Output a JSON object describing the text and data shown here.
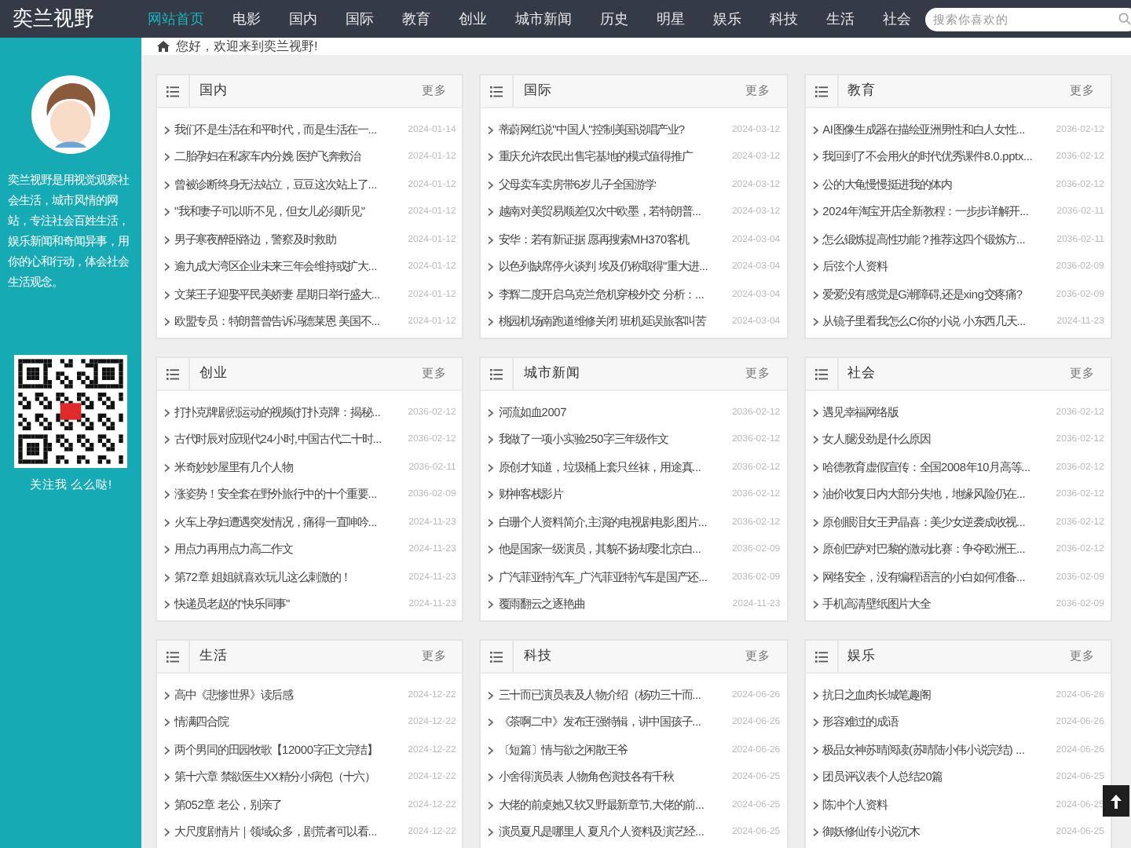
{
  "header": {
    "logo": "奕兰视野",
    "nav": [
      {
        "label": "网站首页",
        "selected": true
      },
      {
        "label": "电影",
        "selected": false
      },
      {
        "label": "国内",
        "selected": false
      },
      {
        "label": "国际",
        "selected": false
      },
      {
        "label": "教育",
        "selected": false
      },
      {
        "label": "创业",
        "selected": false
      },
      {
        "label": "城市新闻",
        "selected": false
      },
      {
        "label": "历史",
        "selected": false
      },
      {
        "label": "明星",
        "selected": false
      },
      {
        "label": "娱乐",
        "selected": false
      },
      {
        "label": "科技",
        "selected": false
      },
      {
        "label": "生活",
        "selected": false
      },
      {
        "label": "社会",
        "selected": false
      }
    ],
    "search": {
      "placeholder": "搜索你喜欢的"
    }
  },
  "breadcrumb": {
    "text": "您好，欢迎来到奕兰视野!"
  },
  "sidebar": {
    "intro": "奕兰视野是用视觉观察社会生活，城市风情的网站，专注社会百姓生活，娱乐新闻和奇闻异事，用你的心和行动，体会社会生活观念。",
    "follow": "关注我 么么哒!"
  },
  "panels": [
    {
      "title": "国内",
      "more": "更多",
      "items": [
        {
          "title": "我们不是生活在和平时代，而是生活在一...",
          "date": "2024-01-14"
        },
        {
          "title": "二胎孕妇在私家车内分娩 医护飞奔救治",
          "date": "2024-01-12"
        },
        {
          "title": "曾被诊断终身无法站立，豆豆这次站上了...",
          "date": "2024-01-12"
        },
        {
          "title": "\"我和妻子可以听不见，但女儿必须听见\"",
          "date": "2024-01-12"
        },
        {
          "title": "男子寒夜醉卧路边，警察及时救助",
          "date": "2024-01-12"
        },
        {
          "title": "逾九成大湾区企业未来三年会维持或扩大...",
          "date": "2024-01-12"
        },
        {
          "title": "文莱王子迎娶平民美娇妻 星期日举行盛大...",
          "date": "2024-01-12"
        },
        {
          "title": "欧盟专员：特朗普曾告诉冯德莱恩 美国不...",
          "date": "2024-01-12"
        }
      ]
    },
    {
      "title": "国际",
      "more": "更多",
      "items": [
        {
          "title": "蒂蔚网红说\"中国人\"控制美国说唱产业?",
          "date": "2024-03-12"
        },
        {
          "title": "重庆允许农民出售宅基地的模式值得推广",
          "date": "2024-03-12"
        },
        {
          "title": "父母卖车卖房带6岁儿子全国游学",
          "date": "2024-03-12"
        },
        {
          "title": "越南对美贸易顺差仅次中欧墨，若特朗普...",
          "date": "2024-03-12"
        },
        {
          "title": "安华：若有新证据 愿再搜索MH370客机",
          "date": "2024-03-04"
        },
        {
          "title": "以色列缺席停火谈判 埃及仍称取得\"重大进...",
          "date": "2024-03-04"
        },
        {
          "title": "李辉二度开启乌克兰危机穿梭外交 分析：...",
          "date": "2024-03-04"
        },
        {
          "title": "桃园机场南跑道维修关闭 班机延误旅客叫苦",
          "date": "2024-03-04"
        }
      ]
    },
    {
      "title": "教育",
      "more": "更多",
      "items": [
        {
          "title": "AI图像生成器在描绘亚洲男性和白人女性...",
          "date": "2036-02-12"
        },
        {
          "title": "我回到了不会用火的时代优秀课件8.0.pptx...",
          "date": "2036-02-12"
        },
        {
          "title": "公的大龟慢慢挺进我的体内",
          "date": "2036-02-12"
        },
        {
          "title": "2024年淘宝开店全新教程：一步步详解开...",
          "date": "2036-02-11"
        },
        {
          "title": "怎么锻炼提高性功能？推荐这四个锻炼方...",
          "date": "2036-02-11"
        },
        {
          "title": "后弦个人资料",
          "date": "2036-02-09"
        },
        {
          "title": "爱爱没有感觉是G潮障碍,还是xing交疼痛?",
          "date": "2036-02-09"
        },
        {
          "title": "从镜子里看我怎么C你的小说 小东西几天...",
          "date": "2024-11-23"
        }
      ]
    },
    {
      "title": "创业",
      "more": "更多",
      "items": [
        {
          "title": "打扑克牌剧烈运动的视频(打扑克牌：揭秘...",
          "date": "2036-02-12"
        },
        {
          "title": "古代时辰对应现代24小时,中国古代二十时...",
          "date": "2036-02-12"
        },
        {
          "title": "米奇妙妙屋里有几个人物",
          "date": "2036-02-11"
        },
        {
          "title": "涨姿势！安全套在野外旅行中的十个重要...",
          "date": "2036-02-09"
        },
        {
          "title": "火车上孕妇遭遇突发情况，痛得一直呻吟...",
          "date": "2024-11-23"
        },
        {
          "title": "用点力再用点力高二作文",
          "date": "2024-11-23"
        },
        {
          "title": "第72章 姐姐就喜欢玩儿这么刺激的！",
          "date": "2024-11-23"
        },
        {
          "title": "快递员老赵的\"快乐同事\"",
          "date": "2024-11-23"
        }
      ]
    },
    {
      "title": "城市新闻",
      "more": "更多",
      "items": [
        {
          "title": "河流如血2007",
          "date": "2036-02-12"
        },
        {
          "title": "我做了一项小实验250字三年级作文",
          "date": "2036-02-12"
        },
        {
          "title": "原创才知道，垃圾桶上套只丝袜，用途真...",
          "date": "2036-02-12"
        },
        {
          "title": "财神客栈影片",
          "date": "2036-02-12"
        },
        {
          "title": "白珊个人资料简介,主演的电视剧电影,图片...",
          "date": "2036-02-12"
        },
        {
          "title": "他是国家一级演员，其貌不扬却娶北京白...",
          "date": "2036-02-09"
        },
        {
          "title": "广汽菲亚特汽车_广汽菲亚特汽车是国产还...",
          "date": "2036-02-09"
        },
        {
          "title": "覆雨翻云之逐艳曲",
          "date": "2024-11-23"
        }
      ]
    },
    {
      "title": "社会",
      "more": "更多",
      "items": [
        {
          "title": "遇见幸福网络版",
          "date": "2036-02-12"
        },
        {
          "title": "女人腿没劲是什么原因",
          "date": "2036-02-12"
        },
        {
          "title": "哈德教育虚假宣传：全国2008年10月高等...",
          "date": "2036-02-12"
        },
        {
          "title": "油价收复日内大部分失地，地缘风险仍在...",
          "date": "2036-02-12"
        },
        {
          "title": "原创眼泪女王尹晶喜：美少女逆袭成收视...",
          "date": "2036-02-12"
        },
        {
          "title": "原创巴萨对巴黎的激动比赛：争夺欧洲王...",
          "date": "2036-02-12"
        },
        {
          "title": "网络安全，没有编程语言的小白如何准备...",
          "date": "2036-02-09"
        },
        {
          "title": "手机高清壁纸图片大全",
          "date": "2036-02-09"
        }
      ]
    },
    {
      "title": "生活",
      "more": "更多",
      "items": [
        {
          "title": "高中《悲惨世界》读后感",
          "date": "2024-12-22"
        },
        {
          "title": "情满四合院",
          "date": "2024-12-22"
        },
        {
          "title": "两个男同的田园牧歌【12000字正文完结】",
          "date": "2024-12-22"
        },
        {
          "title": "第十六章 禁欲医生XX精分小病包（十六）",
          "date": "2024-12-22"
        },
        {
          "title": "第052章 老公，别亲了",
          "date": "2024-12-22"
        },
        {
          "title": "大尺度剧情片｜领域众多，剧荒者可以看...",
          "date": "2024-12-22"
        }
      ]
    },
    {
      "title": "科技",
      "more": "更多",
      "items": [
        {
          "title": "三十而已演员表及人物介绍（杨功三十而...",
          "date": "2024-06-26"
        },
        {
          "title": "《茶啊二中》发布王强特辑，讲中国孩子...",
          "date": "2024-06-26"
        },
        {
          "title": "〔短篇〕情与欲之闲散王爷",
          "date": "2024-06-26"
        },
        {
          "title": "小舍得演员表 人物角色演技各有千秋",
          "date": "2024-06-25"
        },
        {
          "title": "大佬的前桌她又软又野最新章节,大佬的前...",
          "date": "2024-06-25"
        },
        {
          "title": "演员夏凡是哪里人 夏凡个人资料及演艺经...",
          "date": "2024-06-25"
        }
      ]
    },
    {
      "title": "娱乐",
      "more": "更多",
      "items": [
        {
          "title": "抗日之血肉长城笔趣阁",
          "date": "2024-06-26"
        },
        {
          "title": "形容难过的成语",
          "date": "2024-06-26"
        },
        {
          "title": "极品女神苏晴阅读(苏晴陆小伟小说完结) ...",
          "date": "2024-06-26"
        },
        {
          "title": "团员评议表个人总结20篇",
          "date": "2024-06-25"
        },
        {
          "title": "陈冲个人资料",
          "date": "2024-06-25"
        },
        {
          "title": "御妖修仙传小说沉木",
          "date": "2024-06-25"
        }
      ]
    }
  ]
}
